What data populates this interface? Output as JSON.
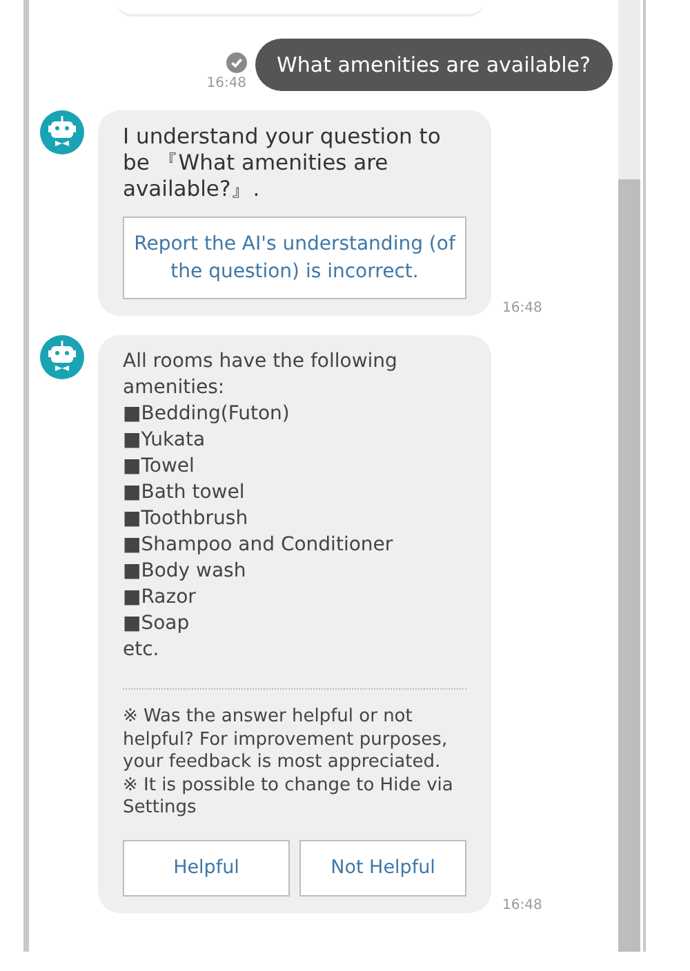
{
  "messages": [
    {
      "kind": "user",
      "text": "What amenities are available?",
      "time": "16:48",
      "read": true
    },
    {
      "kind": "bot",
      "text": "I understand your question to be 『What amenities are available?』.",
      "link_button": "Report the AI's understanding (of the question) is incorrect.",
      "time": "16:48"
    },
    {
      "kind": "bot",
      "intro": "All rooms have the following amenities:",
      "items": [
        "■Bedding(Futon)",
        "■Yukata",
        "■Towel",
        "■Bath towel",
        "■Toothbrush",
        "■Shampoo and Conditioner",
        "■Body wash",
        "■Razor",
        "■Soap"
      ],
      "outro": "etc.",
      "notes": [
        "※ Was the answer helpful or not helpful? For improvement purposes, your feedback is most appreciated.",
        "※ It is possible to change to Hide via Settings"
      ],
      "buttons": [
        "Helpful",
        "Not Helpful"
      ],
      "time": "16:48"
    }
  ]
}
